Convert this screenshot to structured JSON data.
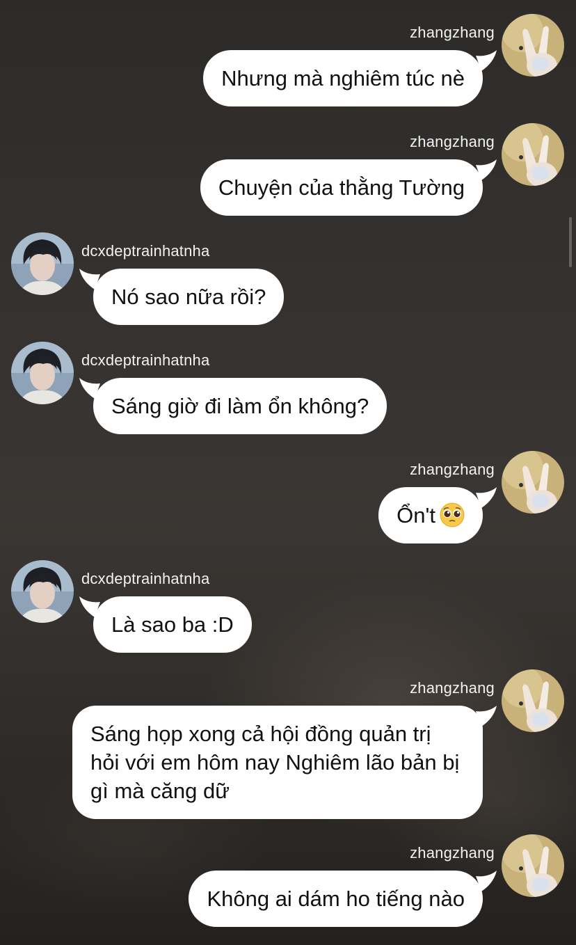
{
  "conversation": {
    "users": {
      "me": "zhangzhang",
      "them": "dcxdeptrainhatnha"
    },
    "messages": [
      {
        "sender": "zhangzhang",
        "text": "Nhưng mà nghiêm túc nè"
      },
      {
        "sender": "zhangzhang",
        "text": "Chuyện của thằng Tường"
      },
      {
        "sender": "dcxdeptrainhatnha",
        "text": "Nó sao nữa rồi?"
      },
      {
        "sender": "dcxdeptrainhatnha",
        "text": "Sáng giờ đi làm ổn không?"
      },
      {
        "sender": "zhangzhang",
        "text": "Ổn't",
        "emoji": "pleading-face-emoji"
      },
      {
        "sender": "dcxdeptrainhatnha",
        "text": "Là sao ba :D"
      },
      {
        "sender": "zhangzhang",
        "text": "Sáng họp xong cả hội đồng quản trị hỏi với em hôm nay Nghiêm lão bản bị gì mà căng dữ"
      },
      {
        "sender": "zhangzhang",
        "text": "Không ai dám ho tiếng nào"
      }
    ]
  },
  "colors": {
    "bubble": "#ffffff",
    "bubble_text": "#111111",
    "username_text": "#f2f2f2",
    "background": "#2f2c2a"
  },
  "icons": {
    "me_avatar": "peace-sign-hand-avatar",
    "them_avatar": "dark-haired-person-avatar"
  }
}
